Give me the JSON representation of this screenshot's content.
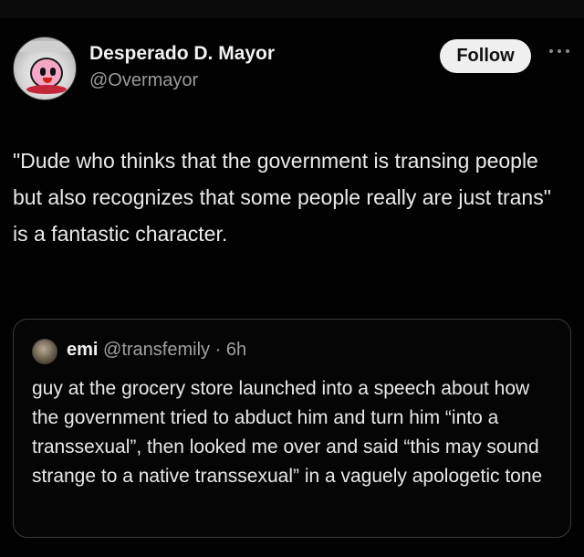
{
  "author": {
    "display_name": "Desperado D. Mayor",
    "handle": "@Overmayor",
    "avatar_icon": "kirby-avatar-icon"
  },
  "actions": {
    "follow_label": "Follow",
    "more_icon": "more-horizontal-icon"
  },
  "tweet": {
    "text": "\"Dude who thinks that the government is transing people but also recognizes that some people really are just trans\" is a fantastic character."
  },
  "quoted_tweet": {
    "display_name": "emi",
    "handle": "@transfemily",
    "separator": "·",
    "time": "6h",
    "text": "guy at the grocery store launched into a speech about how the government tried to abduct him and turn him “into a transsexual”, then looked me over and said “this may sound strange to a native transsexual” in a vaguely apologetic tone"
  },
  "colors": {
    "background": "#020202",
    "primary_text": "#eaeaea",
    "secondary_text": "#9a9a9a",
    "follow_button_bg": "#efefef",
    "card_border": "#3a3a3a"
  }
}
